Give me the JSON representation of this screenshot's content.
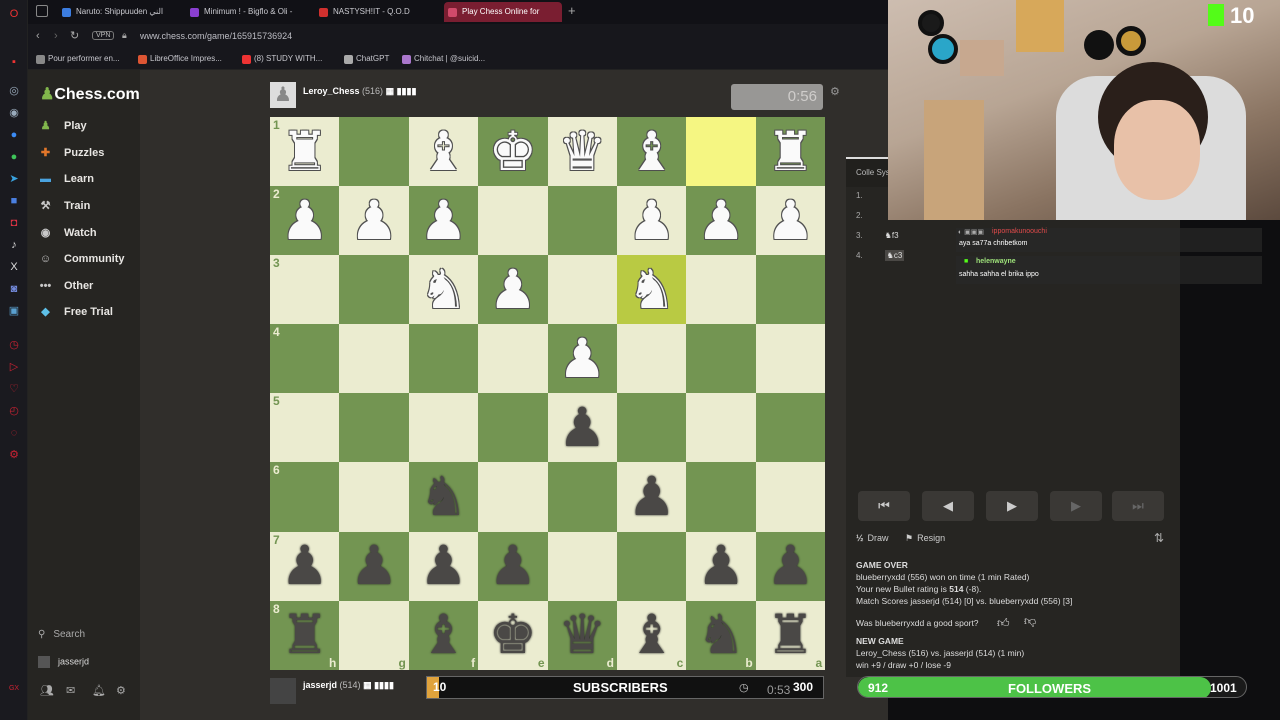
{
  "tabs": [
    {
      "label": "Naruto: Shippuuden الني",
      "color": "#3c7de0"
    },
    {
      "label": "Minimum ! - Bigflo & Oli -",
      "color": "#8a3fd0"
    },
    {
      "label": "NASTYSH!IT - Q.O.D",
      "color": "#d0302e"
    },
    {
      "label": "Play Chess Online for",
      "color": "#d04a6a"
    }
  ],
  "address": {
    "vpn": "VPN",
    "url": "www.chess.com/game/165915736924"
  },
  "bookmarks": [
    {
      "label": "Pour performer en...",
      "color": "#888"
    },
    {
      "label": "LibreOffice Impres...",
      "color": "#d53"
    },
    {
      "label": "(8) STUDY WITH...",
      "color": "#e33"
    },
    {
      "label": "ChatGPT",
      "color": "#aaa"
    },
    {
      "label": "Chitchat | @suicid...",
      "color": "#a7c"
    }
  ],
  "site": {
    "logo": "Chess.com",
    "nav": [
      {
        "label": "Play",
        "icon": "play-icon",
        "color": "#81b64c"
      },
      {
        "label": "Puzzles",
        "icon": "puzzle-icon",
        "color": "#e2772a"
      },
      {
        "label": "Learn",
        "icon": "learn-icon",
        "color": "#4aa3df"
      },
      {
        "label": "Train",
        "icon": "train-icon",
        "color": "#c8c8c8"
      },
      {
        "label": "Watch",
        "icon": "watch-icon",
        "color": "#c8c8c8"
      },
      {
        "label": "Community",
        "icon": "community-icon",
        "color": "#c8c8c8"
      },
      {
        "label": "Other",
        "icon": "more-icon",
        "color": "#c8c8c8"
      },
      {
        "label": "Free Trial",
        "icon": "diamond-icon",
        "color": "#5ec0e8"
      }
    ],
    "search_label": "Search",
    "username": "jasserjd"
  },
  "game": {
    "top_player": {
      "name": "Leroy_Chess",
      "rating": "(516)"
    },
    "top_clock": "0:56",
    "bottom_player": {
      "name": "jasserjd",
      "rating": "(514)"
    },
    "bottom_clock": "0:53",
    "board": [
      [
        "wr",
        "",
        "wb",
        "wk",
        "wq",
        "wb",
        "",
        "wr"
      ],
      [
        "wp",
        "wp",
        "wp",
        "",
        "",
        "wp",
        "wp",
        "wp"
      ],
      [
        "",
        "",
        "wn",
        "wp",
        "",
        "wn",
        "",
        ""
      ],
      [
        "",
        "",
        "",
        "",
        "wp",
        "",
        "",
        ""
      ],
      [
        "",
        "",
        "",
        "",
        "bp",
        "",
        "",
        ""
      ],
      [
        "",
        "",
        "bn",
        "",
        "",
        "bp",
        "",
        ""
      ],
      [
        "bp",
        "bp",
        "bp",
        "bp",
        "",
        "",
        "bp",
        "bp"
      ],
      [
        "br",
        "",
        "bb",
        "bk",
        "bq",
        "bb",
        "bn",
        "br"
      ]
    ],
    "highlight": [
      [
        0,
        6
      ],
      [
        2,
        5
      ]
    ],
    "ranks": [
      "1",
      "2",
      "3",
      "4",
      "5",
      "6",
      "7",
      "8"
    ],
    "files": [
      "h",
      "g",
      "f",
      "e",
      "d",
      "c",
      "b",
      "a"
    ],
    "moves_header": "Colle Sys",
    "moves": [
      {
        "n": "1.",
        "w": ""
      },
      {
        "n": "2.",
        "w": ""
      },
      {
        "n": "3.",
        "w": "f3"
      },
      {
        "n": "4.",
        "w": "c3"
      }
    ],
    "draw_label": "Draw",
    "resign_label": "Resign",
    "draw_icon": "½",
    "game_over": "GAME OVER",
    "result_line": "blueberryxdd (556) won on time (1 min Rated)",
    "rating_line_prefix": "Your new Bullet rating is ",
    "rating_value": "514",
    "rating_change": " (-8).",
    "match_line": "Match Scores jasserjd (514) [0] vs. blueberryxdd (556) [3]",
    "sport_q": "Was blueberryxdd a good sport?",
    "new_game": "NEW GAME",
    "new_game_line": "Leroy_Chess (516) vs. jasserjd (514) (1 min)",
    "record_line": "win +9 / draw +0 / lose -9"
  },
  "chat": [
    {
      "user": "ippomakunoouchi",
      "msg": "aya sa77a chribetkom",
      "user_color": "#e04a4a"
    },
    {
      "user": "helenwayne",
      "msg": "sahha sahha el brika ippo",
      "user_color": "#9ee27a"
    }
  ],
  "overlay": {
    "kick_count": "10",
    "subs": {
      "current": "10",
      "label": "SUBSCRIBERS",
      "goal": "300",
      "progress": 0.03
    },
    "followers": {
      "current": "912",
      "label": "FOLLOWERS",
      "goal": "1001",
      "progress": 0.91
    }
  }
}
